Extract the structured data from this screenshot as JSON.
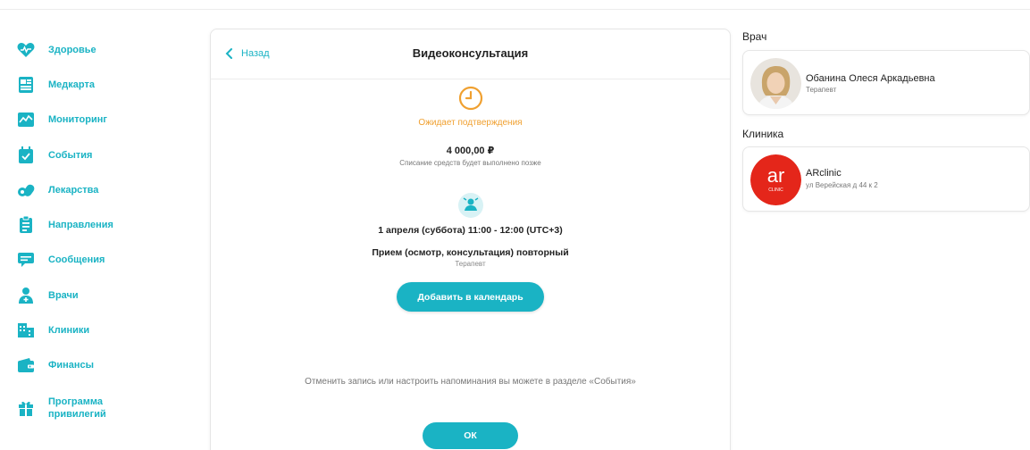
{
  "sidebar": {
    "items": [
      {
        "label": "Здоровье",
        "icon": "heart-icon"
      },
      {
        "label": "Медкарта",
        "icon": "medcard-icon"
      },
      {
        "label": "Мониторинг",
        "icon": "monitoring-icon"
      },
      {
        "label": "События",
        "icon": "calendar-check-icon"
      },
      {
        "label": "Лекарства",
        "icon": "pills-icon"
      },
      {
        "label": "Направления",
        "icon": "clipboard-icon"
      },
      {
        "label": "Сообщения",
        "icon": "chat-icon"
      },
      {
        "label": "Врачи",
        "icon": "doctor-icon"
      },
      {
        "label": "Клиники",
        "icon": "clinic-building-icon"
      },
      {
        "label": "Финансы",
        "icon": "wallet-icon"
      },
      {
        "label": "Программа привилегий",
        "icon": "gift-icon"
      }
    ]
  },
  "consultation": {
    "back_label": "Назад",
    "title": "Видеоконсультация",
    "status": "Ожидает подтверждения",
    "price": "4 000,00 ₽",
    "price_note": "Списание средств будет выполнено позже",
    "datetime": "1 апреля (суббота) 11:00 - 12:00 (UTC+3)",
    "service": "Прием (осмотр, консультация) повторный",
    "service_role": "Терапевт",
    "add_calendar_label": "Добавить в календарь",
    "info_text": "Отменить запись или настроить напоминания вы можете в разделе «События»",
    "ok_label": "ОК"
  },
  "doctor": {
    "section_title": "Врач",
    "name": "Обанина Олеся Аркадьевна",
    "specialty": "Терапевт"
  },
  "clinic": {
    "section_title": "Клиника",
    "name": "ARclinic",
    "address": "ул Верейская д 44 к 2",
    "logo_text": "ar",
    "logo_subtext": "CLINIC"
  },
  "colors": {
    "accent": "#1ab3c4",
    "status": "#f0a030",
    "clinic_logo": "#e4261a"
  }
}
